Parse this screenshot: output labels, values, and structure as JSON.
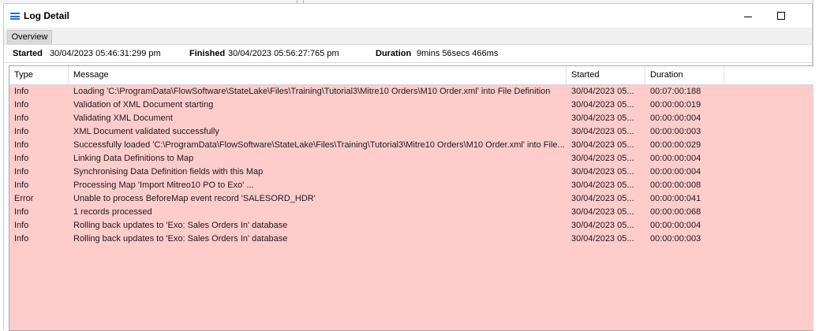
{
  "window": {
    "title": "Log Detail"
  },
  "tabs": [
    {
      "label": "Overview"
    }
  ],
  "summary": {
    "started_label": "Started",
    "started_value": "30/04/2023 05:46:31:299 pm",
    "finished_label": "Finished",
    "finished_value": "30/04/2023 05:56:27:765 pm",
    "duration_label": "Duration",
    "duration_value": "9mins 56secs 466ms"
  },
  "grid": {
    "columns": [
      "Type",
      "Message",
      "Started",
      "Duration"
    ],
    "rows": [
      [
        "Info",
        "Loading 'C:\\ProgramData\\FlowSoftware\\StateLake\\Files\\Training\\Tutorial3\\Mitre10 Orders\\M10 Order.xml' into File Definition",
        "30/04/2023 05...",
        "00:07:00:188"
      ],
      [
        "Info",
        "Validation of XML Document starting",
        "30/04/2023 05...",
        "00:00:00:019"
      ],
      [
        "Info",
        "Validating XML Document",
        "30/04/2023 05...",
        "00:00:00:004"
      ],
      [
        "Info",
        "XML Document validated successfully",
        "30/04/2023 05...",
        "00:00:00:003"
      ],
      [
        "Info",
        "Successfully loaded 'C:\\ProgramData\\FlowSoftware\\StateLake\\Files\\Training\\Tutorial3\\Mitre10 Orders\\M10 Order.xml' into File...",
        "30/04/2023 05...",
        "00:00:00:029"
      ],
      [
        "Info",
        "Linking Data Definitions to Map",
        "30/04/2023 05...",
        "00:00:00:004"
      ],
      [
        "Info",
        "Synchronising Data Definition fields with this Map",
        "30/04/2023 05...",
        "00:00:00:004"
      ],
      [
        "Info",
        "Processing Map 'Import Mitreo10 PO to Exo' ...",
        "30/04/2023 05...",
        "00:00:00:008"
      ],
      [
        "Error",
        "Unable to process BeforeMap event record 'SALESORD_HDR'",
        "30/04/2023 05...",
        "00:00:00:041"
      ],
      [
        "Info",
        "1 records processed",
        "30/04/2023 05...",
        "00:00:00:068"
      ],
      [
        "Info",
        "Rolling back updates to 'Exo: Sales Orders In' database",
        "30/04/2023 05...",
        "00:00:00:004"
      ],
      [
        "Info",
        "Rolling back updates to 'Exo: Sales Orders In' database",
        "30/04/2023 05...",
        "00:00:00:003"
      ]
    ]
  },
  "colors": {
    "row_background": "#ffcccc",
    "accent": "#2b6cc4"
  },
  "icons": {
    "title": "list-icon",
    "minimize": "minimize-icon",
    "maximize": "maximize-icon"
  }
}
